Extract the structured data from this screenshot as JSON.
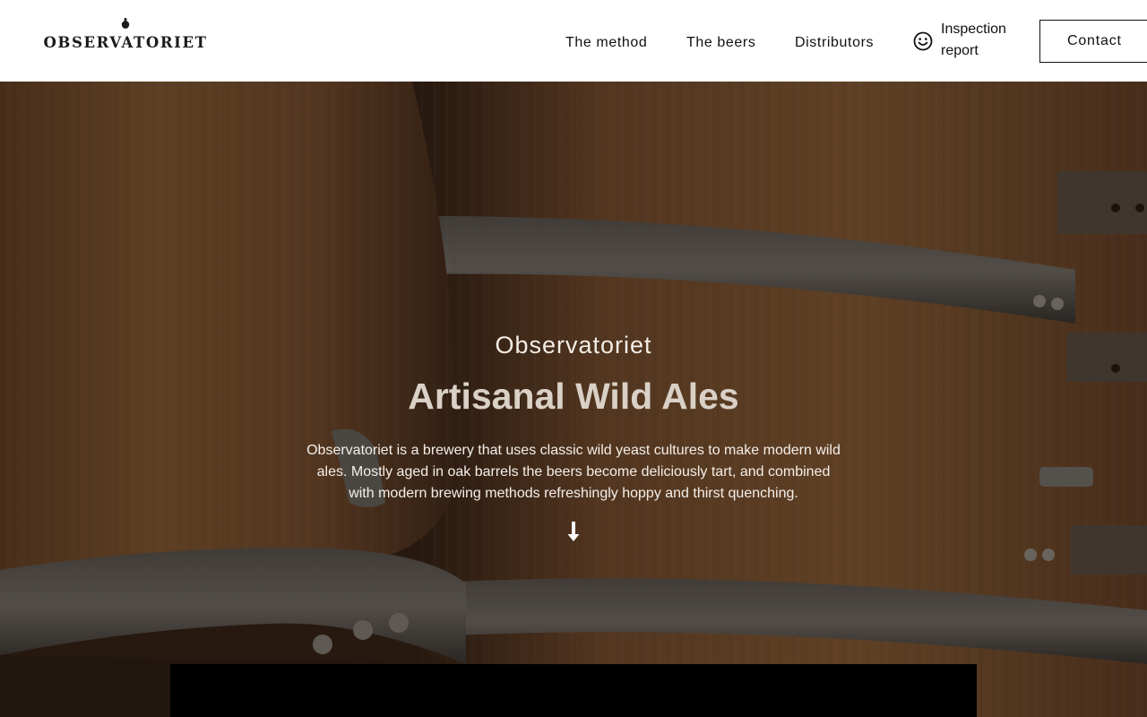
{
  "header": {
    "logo_text": "OBSERVATORIET",
    "nav": {
      "method": "The method",
      "beers": "The beers",
      "distributors": "Distributors"
    },
    "inspection_label": "Inspection report",
    "inspection_icon": "smiley-icon",
    "contact_label": "Contact"
  },
  "hero": {
    "kicker": "Observatoriet",
    "title": "Artisanal Wild Ales",
    "description": "Observatoriet is a brewery that uses classic wild yeast cultures to make modern wild ales. Mostly aged in oak barrels the beers become deliciously tart, and combined with modern brewing methods refreshingly hoppy and thirst quenching.",
    "scroll_icon": "arrow-down-icon",
    "background": "oak-barrels-photo"
  },
  "colors": {
    "header_bg": "#ffffff",
    "text_dark": "#111111",
    "hero_title": "#d9d0c6",
    "hero_text": "#f4efe9",
    "video_block": "#000000"
  }
}
